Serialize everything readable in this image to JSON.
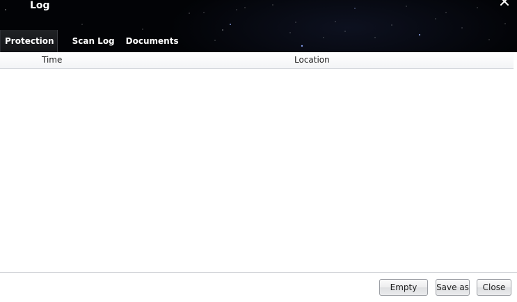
{
  "window": {
    "title": "Log"
  },
  "tabs": [
    {
      "label": "Protection",
      "active": true
    },
    {
      "label": "Scan Log",
      "active": false
    },
    {
      "label": "Documents",
      "active": false
    }
  ],
  "table": {
    "columns": [
      "Time",
      "Location"
    ],
    "rows": []
  },
  "footer": {
    "buttons": {
      "empty": "Empty",
      "save_as": "Save as",
      "close": "Close"
    }
  },
  "icons": {
    "close": "close-icon"
  },
  "colors": {
    "header_bg": "#020306",
    "header_text": "#ffffff",
    "body_bg": "#ffffff"
  }
}
